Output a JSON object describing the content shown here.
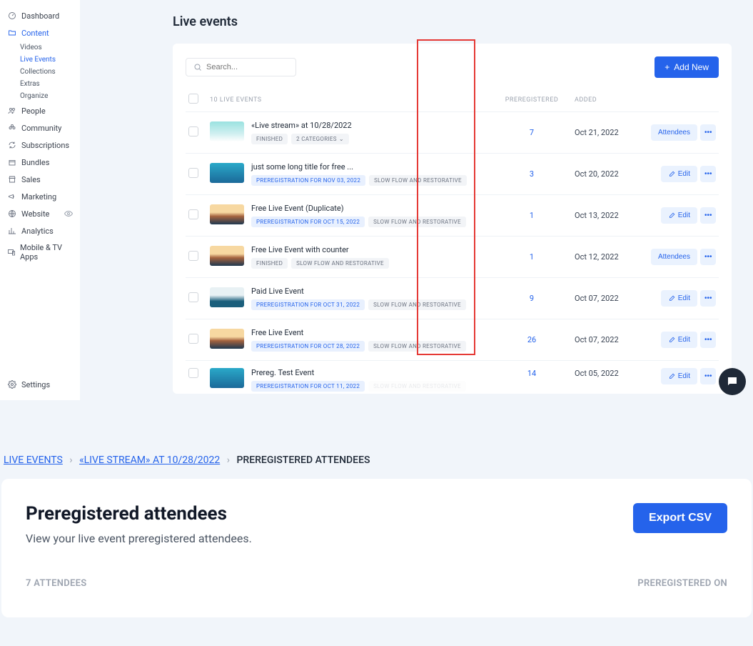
{
  "sidebar": {
    "items": [
      {
        "label": "Dashboard",
        "icon": "dashboard"
      },
      {
        "label": "Content",
        "icon": "folder",
        "active": true
      },
      {
        "label": "People",
        "icon": "people"
      },
      {
        "label": "Community",
        "icon": "community"
      },
      {
        "label": "Subscriptions",
        "icon": "loop"
      },
      {
        "label": "Bundles",
        "icon": "box"
      },
      {
        "label": "Sales",
        "icon": "store"
      },
      {
        "label": "Marketing",
        "icon": "megaphone"
      },
      {
        "label": "Website",
        "icon": "globe"
      },
      {
        "label": "Analytics",
        "icon": "bars"
      },
      {
        "label": "Mobile & TV Apps",
        "icon": "devices"
      }
    ],
    "content_sub": [
      {
        "label": "Videos"
      },
      {
        "label": "Live Events",
        "active": true
      },
      {
        "label": "Collections"
      },
      {
        "label": "Extras"
      },
      {
        "label": "Organize"
      }
    ],
    "settings": "Settings"
  },
  "page": {
    "title": "Live events"
  },
  "toolbar": {
    "search_placeholder": "Search...",
    "add_new": "Add New"
  },
  "table": {
    "count_label": "10 LIVE EVENTS",
    "col_prereg": "PREREGISTERED",
    "col_added": "ADDED"
  },
  "events": [
    {
      "title": "«Live stream» at 10/28/2022",
      "badges": [
        {
          "t": "FINISHED",
          "c": "gray"
        },
        {
          "t": "2 CATEGORIES",
          "c": "gray",
          "chev": true
        }
      ],
      "prereg": "7",
      "added": "Oct 21, 2022",
      "action": "Attendees",
      "thumb": "t1"
    },
    {
      "title": "just some long title for free ...",
      "badges": [
        {
          "t": "PREREGISTRATION FOR NOV 03, 2022",
          "c": "blue"
        },
        {
          "t": "SLOW FLOW AND RESTORATIVE",
          "c": "gray"
        }
      ],
      "prereg": "3",
      "added": "Oct 20, 2022",
      "action": "Edit",
      "action_icon": true,
      "thumb": "t2"
    },
    {
      "title": "Free Live Event (Duplicate)",
      "badges": [
        {
          "t": "PREREGISTRATION FOR OCT 15, 2022",
          "c": "blue"
        },
        {
          "t": "SLOW FLOW AND RESTORATIVE",
          "c": "gray"
        }
      ],
      "prereg": "1",
      "added": "Oct 13, 2022",
      "action": "Edit",
      "action_icon": true,
      "thumb": "t3"
    },
    {
      "title": "Free Live Event with counter",
      "badges": [
        {
          "t": "FINISHED",
          "c": "gray"
        },
        {
          "t": "SLOW FLOW AND RESTORATIVE",
          "c": "gray"
        }
      ],
      "prereg": "1",
      "added": "Oct 12, 2022",
      "action": "Attendees",
      "thumb": "t3"
    },
    {
      "title": "Paid Live Event",
      "badges": [
        {
          "t": "PREREGISTRATION FOR OCT 31, 2022",
          "c": "blue"
        },
        {
          "t": "SLOW FLOW AND RESTORATIVE",
          "c": "gray"
        }
      ],
      "prereg": "9",
      "added": "Oct 07, 2022",
      "action": "Edit",
      "action_icon": true,
      "thumb": "t4"
    },
    {
      "title": "Free Live Event",
      "badges": [
        {
          "t": "PREREGISTRATION FOR OCT 28, 2022",
          "c": "blue"
        },
        {
          "t": "SLOW FLOW AND RESTORATIVE",
          "c": "gray"
        }
      ],
      "prereg": "26",
      "added": "Oct 07, 2022",
      "action": "Edit",
      "action_icon": true,
      "thumb": "t3"
    },
    {
      "title": "Prereg. Test Event",
      "badges": [
        {
          "t": "PREREGISTRATION FOR OCT 11, 2022",
          "c": "blue"
        },
        {
          "t": "SLOW FLOW AND RESTORATIVE",
          "c": "gray",
          "cut": true
        }
      ],
      "prereg": "14",
      "added": "Oct 05, 2022",
      "action": "Edit",
      "action_icon": true,
      "thumb": "t2"
    }
  ],
  "breadcrumb": {
    "a": "LIVE EVENTS",
    "b": "«LIVE STREAM» AT 10/28/2022",
    "c": "PREREGISTERED ATTENDEES"
  },
  "detail": {
    "title": "Preregistered attendees",
    "sub": "View your live event preregistered attendees.",
    "export": "Export CSV",
    "col_a": "7 ATTENDEES",
    "col_b": "PREREGISTERED ON"
  }
}
